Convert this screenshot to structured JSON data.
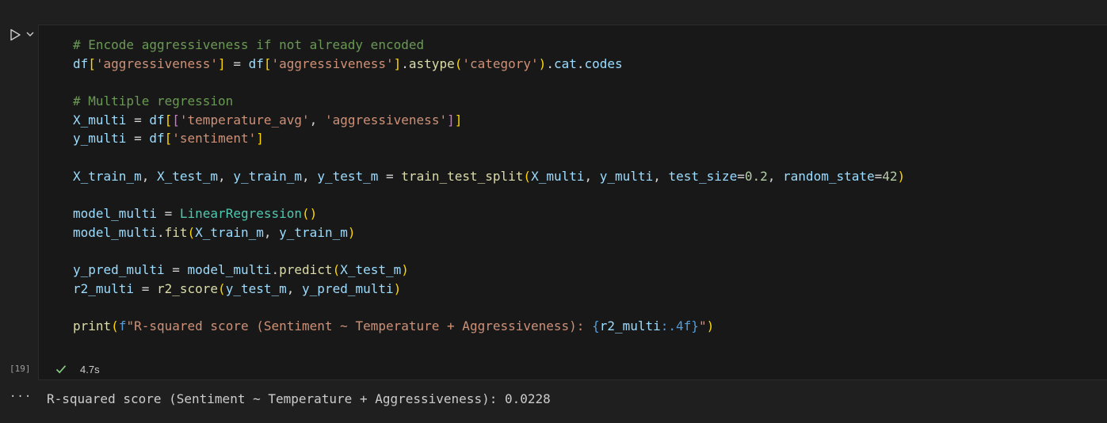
{
  "cell": {
    "execution_count": "[19]",
    "exec_time": "4.7s",
    "status": "success",
    "run_icon": "play-icon",
    "dropdown_icon": "chevron-down-icon",
    "status_icon": "check-icon"
  },
  "code_lines": [
    "# Encode aggressiveness if not already encoded",
    "df['aggressiveness'] = df['aggressiveness'].astype('category').cat.codes",
    "",
    "# Multiple regression",
    "X_multi = df[['temperature_avg', 'aggressiveness']]",
    "y_multi = df['sentiment']",
    "",
    "X_train_m, X_test_m, y_train_m, y_test_m = train_test_split(X_multi, y_multi, test_size=0.2, random_state=42)",
    "",
    "model_multi = LinearRegression()",
    "model_multi.fit(X_train_m, y_train_m)",
    "",
    "y_pred_multi = model_multi.predict(X_test_m)",
    "r2_multi = r2_score(y_test_m, y_pred_multi)",
    "",
    "print(f\"R-squared score (Sentiment ~ Temperature + Aggressiveness): {r2_multi:.4f}\")"
  ],
  "output": {
    "more_label": "···",
    "text": "R-squared score (Sentiment ~ Temperature + Aggressiveness): 0.0228"
  },
  "colors": {
    "background": "#1f1f1f",
    "editor_background": "#181818",
    "comment": "#6a9955",
    "string": "#ce9178",
    "variable": "#9cdcfe",
    "function": "#dcdcaa",
    "class": "#4ec9b0",
    "number": "#b5cea8",
    "success": "#89d185"
  }
}
